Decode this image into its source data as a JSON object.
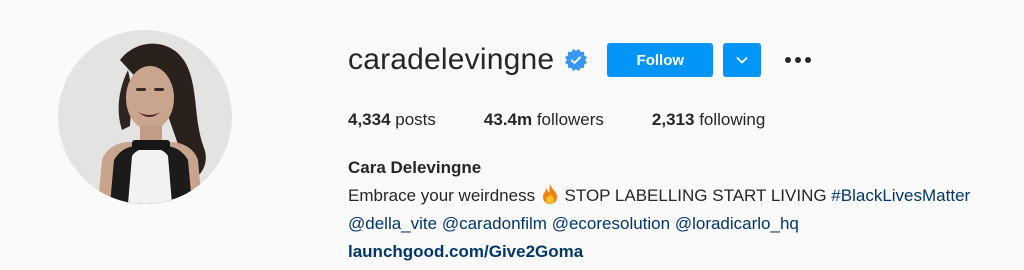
{
  "profile": {
    "username": "caradelevingne",
    "verified": true,
    "follow_label": "Follow",
    "accent_color": "#0095f6",
    "link_color": "#00376b"
  },
  "icons": {
    "verified": "verified-badge-icon",
    "dropdown": "chevron-down-icon",
    "more": "more-options-icon",
    "fire": "fire-emoji-icon"
  },
  "stats": {
    "posts_count": "4,334",
    "posts_label": " posts",
    "followers_count": "43.4m",
    "followers_label": " followers",
    "following_count": "2,313",
    "following_label": " following"
  },
  "bio": {
    "full_name": "Cara Delevingne",
    "line1_text": "Embrace your weirdness",
    "line1_after_emoji": " STOP LABELLING START LIVING ",
    "hashtag": "#BlackLivesMatter",
    "mentions": [
      "@della_vite",
      "@caradonfilm",
      "@ecoresolution",
      "@loradicarlo_hq"
    ],
    "website": "launchgood.com/Give2Goma"
  }
}
